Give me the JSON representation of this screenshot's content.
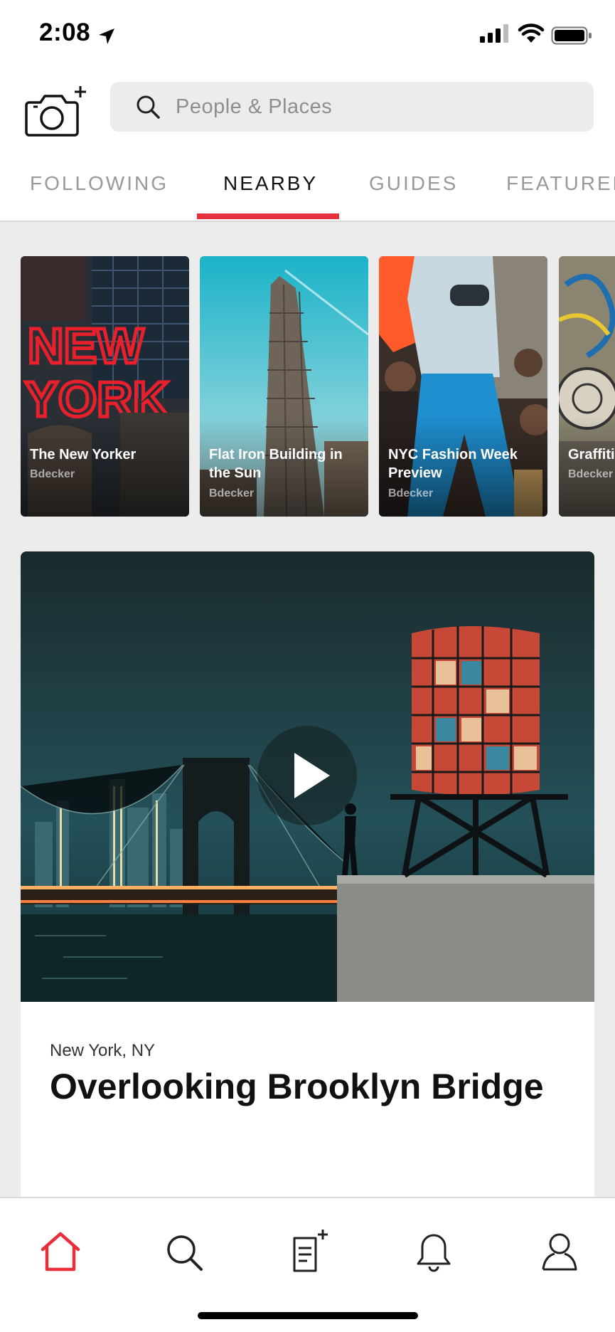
{
  "status_bar": {
    "time": "2:08"
  },
  "search": {
    "placeholder": "People & Places"
  },
  "tabs": [
    {
      "label": "FOLLOWING",
      "active": false
    },
    {
      "label": "NEARBY",
      "active": true
    },
    {
      "label": "GUIDES",
      "active": false
    },
    {
      "label": "FEATURED",
      "active": false
    }
  ],
  "stories": [
    {
      "title": "The New Yorker",
      "author": "Bdecker"
    },
    {
      "title": "Flat Iron Building in the Sun",
      "author": "Bdecker"
    },
    {
      "title": "NYC Fashion Week Preview",
      "author": "Bdecker"
    },
    {
      "title": "Graffiti",
      "author": "Bdecker"
    }
  ],
  "post": {
    "location": "New York, NY",
    "title": "Overlooking Brooklyn Bridge"
  },
  "nav": {
    "active": "home",
    "items": [
      "home",
      "search",
      "new-post",
      "notifications",
      "profile"
    ]
  },
  "colors": {
    "accent": "#e8303c",
    "background": "#ececec",
    "tab_inactive": "#999999"
  }
}
